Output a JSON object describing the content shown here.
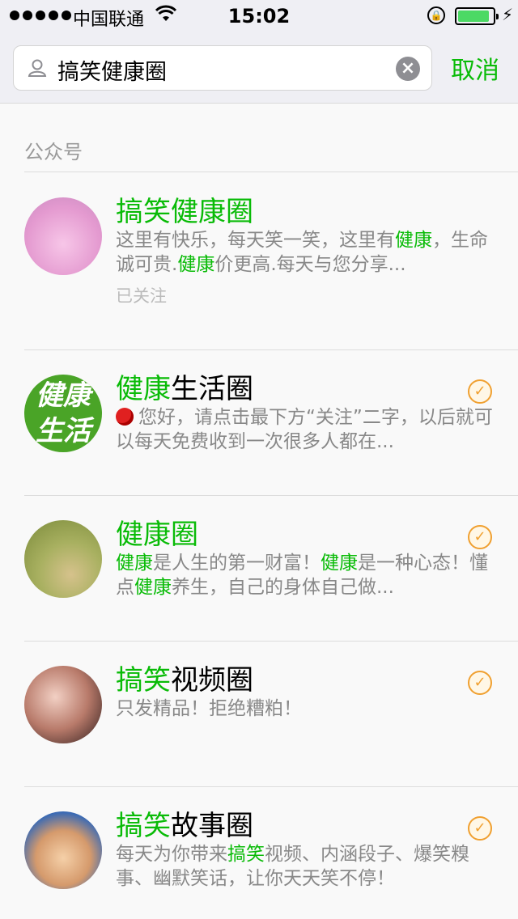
{
  "status_bar": {
    "carrier": "中国联通",
    "time": "15:02",
    "signal_icon": "signal-dots-icon",
    "wifi_icon": "wifi-icon",
    "battery_level": 0.9,
    "battery_color": "#4cd964"
  },
  "search": {
    "query": "搞笑健康圈",
    "cancel_label": "取消"
  },
  "section": {
    "title": "公众号"
  },
  "accent_color": "#09bb07",
  "results": [
    {
      "name_hl": "搞笑健康圈",
      "name_rest": "",
      "desc_parts": [
        "这里有快乐，每天笑一笑，这里有",
        "健康",
        "，生命诚可贵.",
        "健康",
        "价更高.每天与您分享..."
      ],
      "followed_label": "已关注",
      "checked": false
    },
    {
      "name_hl": "健康",
      "name_rest": "生活圈",
      "desc_text": "您好，请点击最下方“关注”二字，以后就可以每天免费收到一次很多人都在...",
      "avatar_text": "健康生活",
      "checked": true
    },
    {
      "name_hl": "健康圈",
      "name_rest": "",
      "desc_parts": [
        "健康",
        "是人生的第一财富！",
        "健康",
        "是一种心态！懂点",
        "健康",
        "养生，自己的身体自己做..."
      ],
      "checked": true
    },
    {
      "name_hl": "搞笑",
      "name_rest": "视频圈",
      "desc_text": "只发精品！拒绝糟粕！",
      "checked": true
    },
    {
      "name_hl": "搞笑",
      "name_rest": "故事圈",
      "desc_parts": [
        "每天为你带来",
        "搞笑",
        "视频、内涵段子、爆笑糗事、幽默笑话，让你天天笑不停！"
      ],
      "checked": true
    }
  ]
}
